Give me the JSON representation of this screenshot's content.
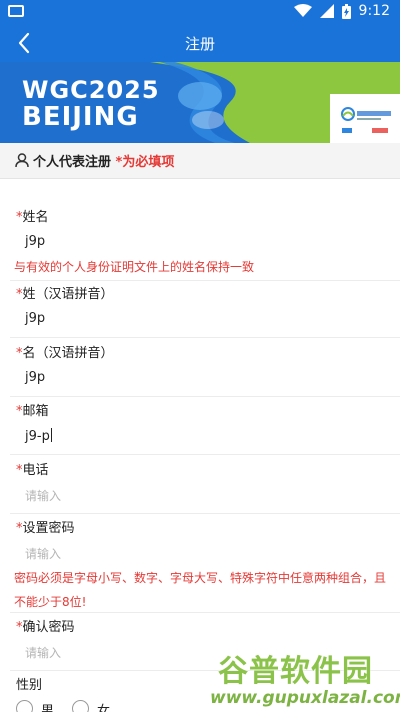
{
  "status_bar": {
    "time": "9:12"
  },
  "app_bar": {
    "title": "注册"
  },
  "banner": {
    "line1": "WGC2025",
    "line2": "BEIJING",
    "logo_text": "WGC2025"
  },
  "section": {
    "title": "个人代表注册",
    "required_note": "*为必填项"
  },
  "form": {
    "fields": [
      {
        "star": "*",
        "label": "姓名",
        "value": "j9p"
      },
      {
        "star": "*",
        "label": "姓（汉语拼音）",
        "value": "j9p"
      },
      {
        "star": "*",
        "label": "名（汉语拼音）",
        "value": "j9p"
      },
      {
        "star": "*",
        "label": "邮箱",
        "value": "j9-p"
      },
      {
        "star": "*",
        "label": "电话",
        "placeholder": "请输入"
      },
      {
        "star": "*",
        "label": "设置密码",
        "placeholder": "请输入"
      },
      {
        "star": "*",
        "label": "确认密码",
        "placeholder": "请输入"
      }
    ],
    "name_hint": "与有效的个人身份证明文件上的姓名保持一致",
    "password_hint": "密码必须是字母小写、数字、字母大写、特殊字符中任意两种组合，且不能少于8位!",
    "gender": {
      "label": "性别",
      "options": [
        "男",
        "女"
      ]
    }
  },
  "watermark": {
    "line1": "谷普软件园",
    "line2": "www.gupuxlazal.com"
  },
  "colors": {
    "primary": "#1a73d9",
    "required": "#e53935",
    "banner_green": "#8dc63f"
  }
}
